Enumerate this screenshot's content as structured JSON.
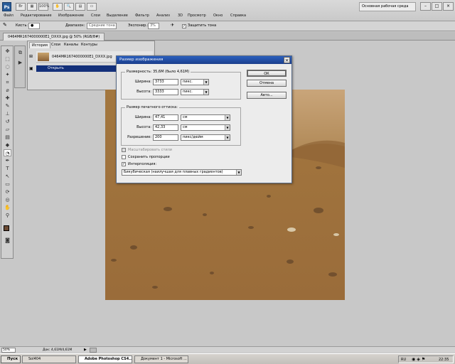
{
  "app": {
    "logo_text": "Ps"
  },
  "menu": {
    "items": [
      "Файл",
      "Редактирование",
      "Изображение",
      "Слои",
      "Выделение",
      "Фильтр",
      "Анализ",
      "3D",
      "Просмотр",
      "Окно",
      "Справка"
    ]
  },
  "topbar": {
    "zoom_label": "100%",
    "workspace": "Основная рабочая среда"
  },
  "options": {
    "brush_label": "Кисть:",
    "range_label": "Диапазон:",
    "range_value": "Средние тона",
    "exposure_label": "Экспонир.:",
    "exposure_value": "3%",
    "protect_label": "Защитить тона"
  },
  "document": {
    "tab_title": "0464MR1674000000E1_DXXX.jpg @ 50% (RGB/8#)"
  },
  "panel": {
    "tabs": [
      "История",
      "Слои",
      "Каналы",
      "Контуры"
    ],
    "snapshot_name": "0464MR1674000000E1_DXXX.jpg",
    "history_item": "Открыть"
  },
  "dialog": {
    "title": "Размер изображения",
    "pixel_dims_label": "Размерность:",
    "pixel_dims_value": "35,6M (было 4,61M)",
    "width_label": "Ширина:",
    "width_px": "3733",
    "height_label": "Высота:",
    "height_px": "3333",
    "unit_pixels": "пикс.",
    "print_size_label": "Размер печатного оттиска:",
    "print_width": "47,41",
    "print_height": "42,33",
    "unit_cm": "см",
    "resolution_label": "Разрешение:",
    "resolution": "200",
    "resolution_unit": "пикс/дюйм",
    "scale_styles": "Масштабировать стили",
    "constrain": "Сохранить пропорции",
    "resample": "Интерполяция:",
    "method": "Бикубическая (наилучшая для плавных градиентов)",
    "ok": "ОК",
    "cancel": "Отмена",
    "auto": "Авто..."
  },
  "status": {
    "zoom": "50%",
    "doc_info": "Док: 4,61M/4,61M"
  },
  "taskbar": {
    "start": "Пуск",
    "tasks": [
      "Sol404",
      "Adobe Photoshop CS4...",
      "Документ 1 - Microsoft ..."
    ],
    "lang": "RU",
    "time": "22:35"
  }
}
